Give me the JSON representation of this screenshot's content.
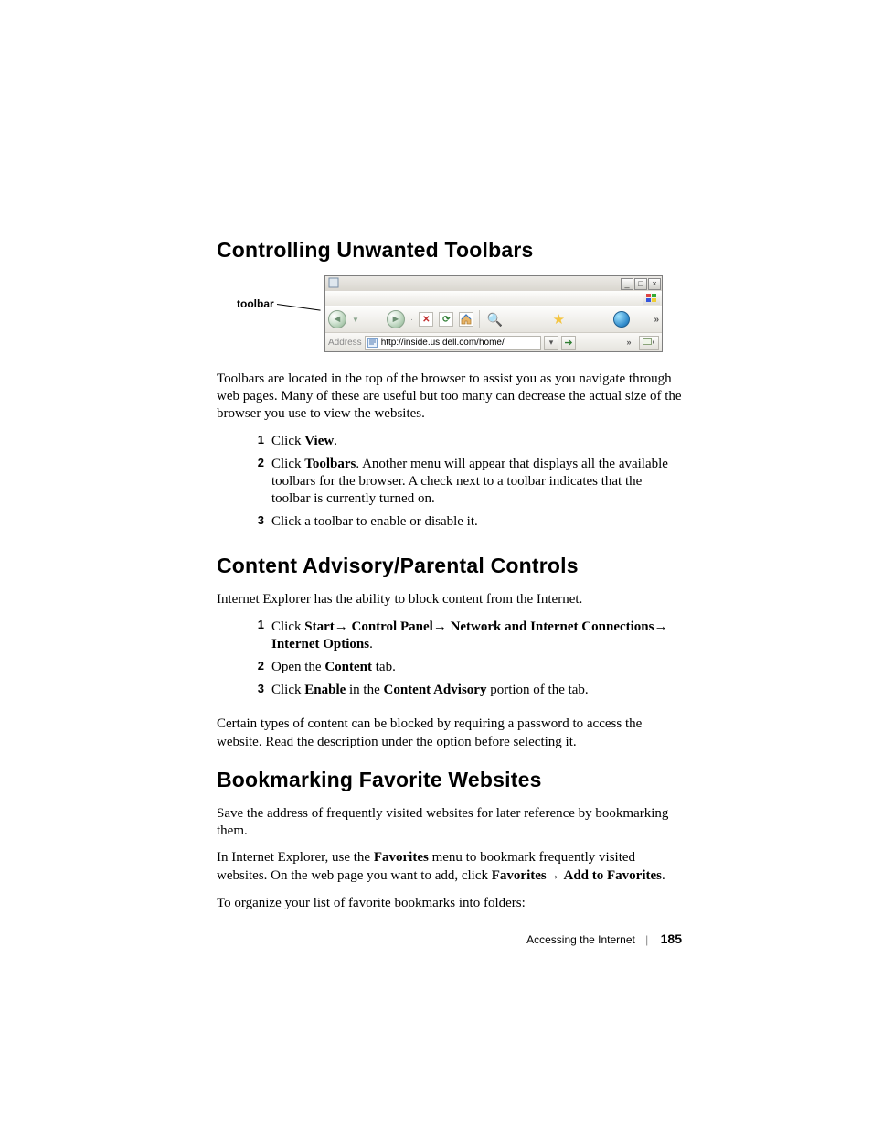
{
  "sections": {
    "toolbars": {
      "heading": "Controlling Unwanted Toolbars",
      "figure_label": "toolbar",
      "address_label": "Address",
      "address_url": "http://inside.us.dell.com/home/",
      "intro": "Toolbars are located in the top of the browser to assist you as you navigate through web pages. Many of these are useful but too many can decrease the actual size of the browser you use to view the websites.",
      "steps": [
        {
          "pre": "Click ",
          "bold": "View",
          "post": "."
        },
        {
          "pre": "Click ",
          "bold": "Toolbars",
          "post": ". Another menu will appear that displays all the available toolbars for the browser. A check next to a toolbar indicates that the toolbar is currently turned on."
        },
        {
          "pre": "Click a toolbar to enable or disable it.",
          "bold": "",
          "post": ""
        }
      ]
    },
    "parental": {
      "heading": "Content Advisory/Parental Controls",
      "intro": "Internet Explorer has the ability to block content from the Internet.",
      "step1_pre": "Click ",
      "step1_b1": "Start",
      "step1_b2": "Control Panel",
      "step1_b3": "Network and Internet Connections",
      "step1_b4": "Internet Options",
      "step2_pre": "Open the ",
      "step2_bold": "Content",
      "step2_post": " tab.",
      "step3_pre": "Click ",
      "step3_b1": "Enable",
      "step3_mid": " in the ",
      "step3_b2": "Content Advisory",
      "step3_post": " portion of the tab.",
      "outro": "Certain types of content can be blocked by requiring a password to access the website. Read the description under the option before selecting it."
    },
    "bookmarks": {
      "heading": "Bookmarking Favorite Websites",
      "p1": "Save the address of frequently visited websites for later reference by bookmarking them.",
      "p2_pre": "In Internet Explorer, use the ",
      "p2_b1": "Favorites",
      "p2_mid": " menu to bookmark frequently visited websites. On the web page you want to add, click ",
      "p2_b2": "Favorites",
      "p2_b3": "Add to Favorites",
      "p3": "To organize your list of favorite bookmarks into folders:"
    }
  },
  "icons": {
    "minimize": "_",
    "maximize": "□",
    "close": "×",
    "back": "◄",
    "forward": "►",
    "stop": "✕",
    "refresh": "⟳",
    "search": "🔍",
    "star": "★",
    "chevrons": "»",
    "dropdown": "▾",
    "go": "➔",
    "links_dd": "▾"
  },
  "footer": {
    "section": "Accessing the Internet",
    "page": "185"
  },
  "arrow": "→"
}
